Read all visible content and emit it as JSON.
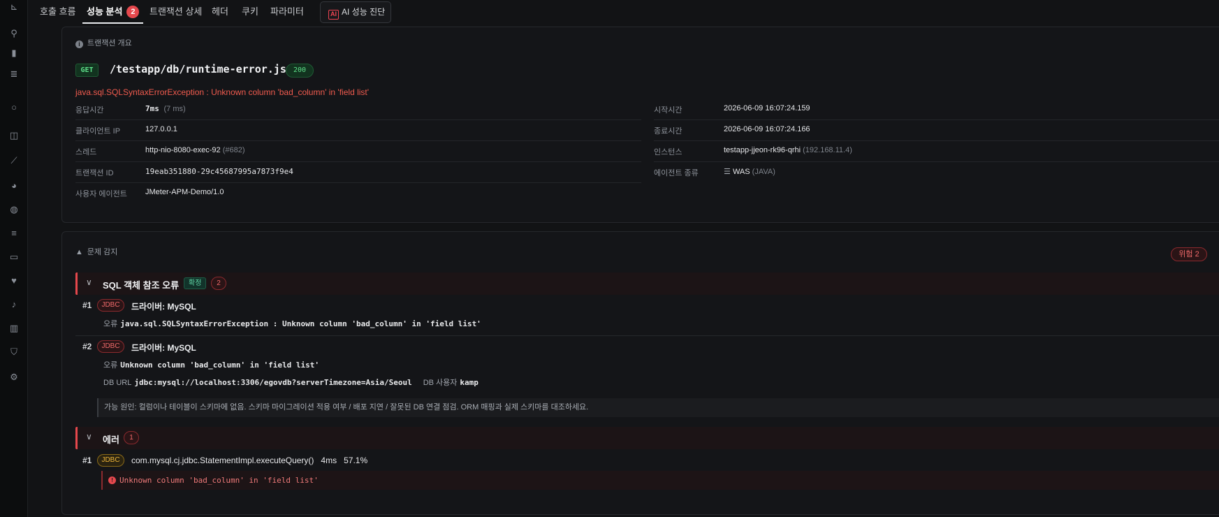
{
  "tabs": [
    {
      "label": "호출 흐름"
    },
    {
      "label": "성능 분석",
      "badge": "2"
    },
    {
      "label": "트랜잭션 상세"
    },
    {
      "label": "헤더"
    },
    {
      "label": "쿠키"
    },
    {
      "label": "파라미터"
    }
  ],
  "ai_button": {
    "icon_text": "AI",
    "label": "AI 성능 진단"
  },
  "overview": {
    "section_title": "트랜잭션 개요",
    "method": "GET",
    "url": "/testapp/db/runtime-error.jsp",
    "status": "200",
    "exception": "java.sql.SQLSyntaxErrorException : Unknown column 'bad_column' in 'field list'",
    "left": [
      {
        "key": "응답시간",
        "value": "7ms",
        "extra": "(7 ms)"
      },
      {
        "key": "클라이언트 IP",
        "value": "127.0.0.1",
        "extra": ""
      },
      {
        "key": "스레드",
        "value": "http-nio-8080-exec-92",
        "extra": "(#682)"
      },
      {
        "key": "트랜잭션 ID",
        "value": "19eab351880-29c45687995a7873f9e4",
        "extra": ""
      },
      {
        "key": "사용자 에이전트",
        "value": "JMeter-APM-Demo/1.0",
        "extra": ""
      }
    ],
    "right": [
      {
        "key": "시작시간",
        "value": "2026-06-09 16:07:24.159",
        "extra": ""
      },
      {
        "key": "종료시간",
        "value": "2026-06-09 16:07:24.166",
        "extra": ""
      },
      {
        "key": "인스턴스",
        "value": "testapp-jjeon-rk96-qrhi",
        "extra": "(192.168.11.4)"
      },
      {
        "key": "에이전트 종류",
        "value": "WAS",
        "extra": "(JAVA)"
      }
    ]
  },
  "problems": {
    "section_title": "문제 감지",
    "risk_badge": "위험 2",
    "group1": {
      "title": "SQL 객체 참조 오류",
      "tag": "확정",
      "count": "2",
      "items": [
        {
          "num": "#1",
          "tag": "JDBC",
          "driver": "드라이버: MySQL",
          "error_label": "오류",
          "error": "java.sql.SQLSyntaxErrorException : Unknown column 'bad_column' in 'field list'"
        },
        {
          "num": "#2",
          "tag": "JDBC",
          "driver": "드라이버: MySQL",
          "error_label": "오류",
          "error": "Unknown column 'bad_column' in 'field list'",
          "db_url_label": "DB URL",
          "db_url": "jdbc:mysql://localhost:3306/egovdb?serverTimezone=Asia/Seoul",
          "db_user_label": "DB 사용자",
          "db_user": "kamp"
        }
      ],
      "cause": "가능 원인: 컬럼이나 테이블이 스키마에 없음. 스키마 마이그레이션 적용 여부 / 배포 지연 / 잘못된 DB 연결 점검. ORM 매핑과 실제 스키마를 대조하세요."
    },
    "group2": {
      "title": "에러",
      "count": "1",
      "item": {
        "num": "#1",
        "tag": "JDBC",
        "method": "com.mysql.cj.jdbc.StatementImpl.executeQuery()",
        "time": "4ms",
        "pct": "57.1%",
        "error": "Unknown column 'bad_column' in 'field list'"
      }
    }
  }
}
